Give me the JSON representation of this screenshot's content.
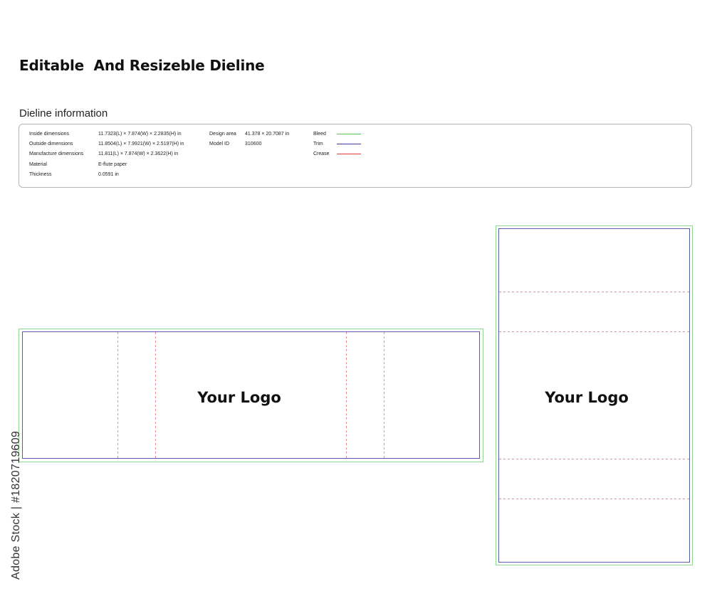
{
  "header": {
    "title": "Editable  And Resizeble Dieline",
    "subtitle": "Dieline information"
  },
  "info": {
    "rows": [
      {
        "label": "Inside dimensions",
        "value": "11.7323(L) × 7.874(W) × 2.2835(H) in"
      },
      {
        "label": "Outside dimensions",
        "value": "11.8504(L) × 7.9921(W) × 2.5197(H) in"
      },
      {
        "label": "Manufacture dimensions",
        "value": "11.811(L) × 7.874(W) × 2.3622(H) in"
      },
      {
        "label": "Material",
        "value": "E-flute paper"
      },
      {
        "label": "Thickness",
        "value": "0.0591 in"
      }
    ],
    "design_area_label": "Design area",
    "design_area_value": "41.378 × 20.7087 in",
    "model_id_label": "Model ID",
    "model_id_value": "310600",
    "legend": [
      {
        "label": "Bleed",
        "color": "#5cc45c"
      },
      {
        "label": "Trim",
        "color": "#3a3a9a"
      },
      {
        "label": "Crease",
        "color": "#e03a3a"
      }
    ]
  },
  "panels": {
    "left_logo": "Your Logo",
    "right_logo": "Your Logo"
  },
  "colors": {
    "bleed": "#8fd88f",
    "trim": "#5a5aa8",
    "crease": "#e87070"
  },
  "watermark": {
    "credit": "Adobe Stock | #1820719609"
  }
}
